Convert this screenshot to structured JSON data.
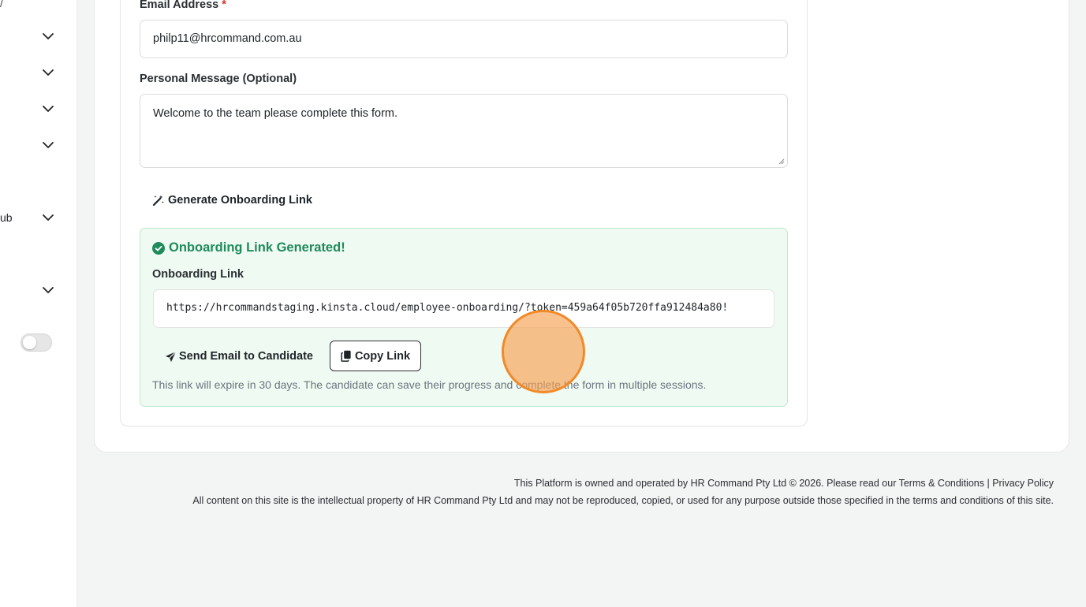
{
  "sidebar": {
    "slash_fragment": "/",
    "items": [
      {
        "fragment": ""
      },
      {
        "fragment": ""
      },
      {
        "fragment": ""
      },
      {
        "fragment": ""
      },
      {
        "fragment": "ub"
      },
      {
        "fragment": ""
      }
    ],
    "toggle_on": false
  },
  "form": {
    "email_label": "Email Address",
    "required_mark": "*",
    "email_value": "philp11@hrcommand.com.au",
    "message_label": "Personal Message (Optional)",
    "message_value": "Welcome to the team please complete this form.",
    "generate_button": "Generate Onboarding Link"
  },
  "result": {
    "success_title": "Onboarding Link Generated!",
    "link_label": "Onboarding Link",
    "link_value": "https://hrcommandstaging.kinsta.cloud/employee-onboarding/?token=459a64f05b720ffa912484a80!",
    "send_button": "Send Email to Candidate",
    "copy_button": "Copy Link",
    "expiry_note": "This link will expire in 30 days. The candidate can save their progress and complete the form in multiple sessions.",
    "success_color": "#1f8a5b"
  },
  "footer": {
    "line1_prefix": "This Platform is owned and operated by HR Command Pty Ltd © 2026. Please read our",
    "terms_link": "Terms & Conditions",
    "separator": "|",
    "privacy_link": "Privacy Policy",
    "line2": "All content on this site is the intellectual property of HR Command Pty Ltd and may not be reproduced, copied, or used for any purpose outside those specified in the terms and conditions of this site."
  }
}
